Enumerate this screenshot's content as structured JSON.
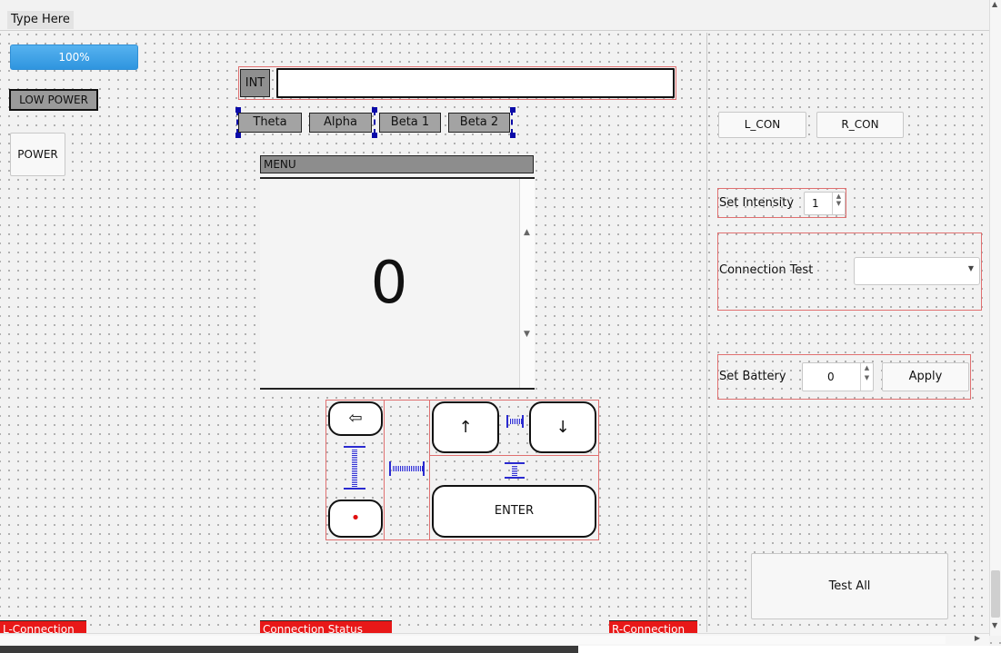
{
  "menubar": {
    "item": "Type Here"
  },
  "left": {
    "progress_percent": 100,
    "progress_text": "100%",
    "low_power_label": "LOW POWER",
    "power_button": "POWER"
  },
  "center": {
    "int_label": "INT",
    "int_value": "",
    "bands": [
      "Theta",
      "Alpha",
      "Beta 1",
      "Beta 2"
    ],
    "menu_title": "MENU",
    "display_value": "0",
    "keypad": {
      "back": "⇦",
      "up": "↑",
      "down": "↓",
      "dot": "•",
      "enter": "ENTER"
    }
  },
  "right": {
    "l_con": "L_CON",
    "r_con": "R_CON",
    "set_intensity_label": "Set Intensity",
    "intensity_value": "1",
    "connection_test_label": "Connection Test",
    "connection_test_value": "",
    "set_battery_label": "Set Battery",
    "battery_value": "0",
    "apply_button": "Apply",
    "test_all_button": "Test All"
  },
  "status": {
    "left": "L-Connection",
    "center": "Connection Status",
    "right": "R-Connection"
  },
  "colors": {
    "accent_blue": "#2f95df",
    "status_red": "#e81818",
    "layout_red": "#e07070",
    "selection_blue": "#0a0aa8"
  }
}
